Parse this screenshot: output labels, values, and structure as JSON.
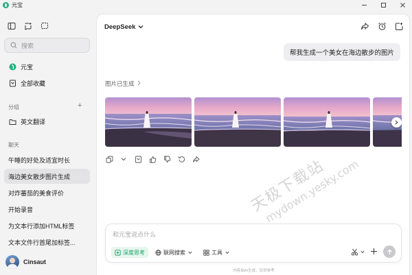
{
  "window": {
    "title": "元宝"
  },
  "sidebar": {
    "search_placeholder": "搜索",
    "nav": [
      {
        "label": "元宝",
        "icon": "yuanbao-logo-icon"
      },
      {
        "label": "全部收藏",
        "icon": "bookmark-icon"
      }
    ],
    "groups_title": "分组",
    "groups": [
      {
        "label": "英文翻译",
        "icon": "folder-icon"
      }
    ],
    "chats_title": "聊天",
    "chats": [
      {
        "label": "午睡的好处及适宜时长",
        "active": false
      },
      {
        "label": "海边美女散步图片生成",
        "active": true
      },
      {
        "label": "对炸蕃茄的美食评价",
        "active": false
      },
      {
        "label": "开始录音",
        "active": false
      },
      {
        "label": "为文本行添加HTML标签",
        "active": false
      },
      {
        "label": "文本文件行首尾加标签...",
        "active": false
      }
    ],
    "user": {
      "name": "Cinsaut"
    }
  },
  "main": {
    "model": "DeepSeek",
    "user_message": "帮我生成一个美女在海边散步的图片",
    "gen_label": "图片已生成",
    "composer": {
      "placeholder": "和元宝说点什么",
      "deep_think": "深度思考",
      "web_search": "联网搜索",
      "tools": "工具"
    },
    "footer": "内容由AI生成，仅供参考"
  },
  "watermark": {
    "line1": "天极下载站",
    "line2": "mydown.yesky.com"
  },
  "colors": {
    "accent": "#1db37b",
    "active_item": "#e3e3e5",
    "bubble": "#eeeef0"
  }
}
